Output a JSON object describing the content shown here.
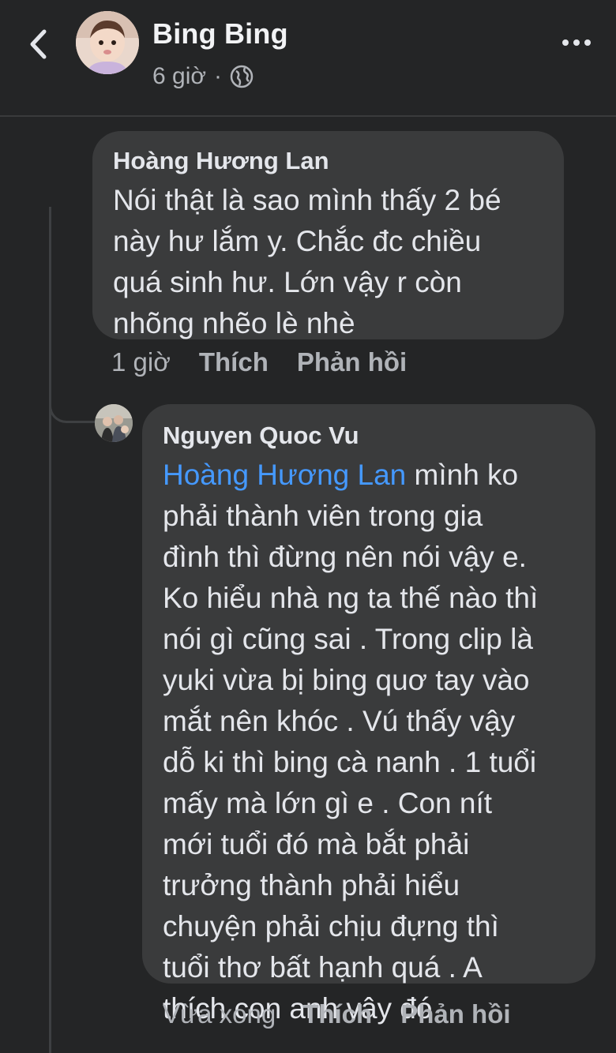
{
  "header": {
    "name": "Bing Bing",
    "time": "6 giờ",
    "separator": "·",
    "audience_icon": "globe-icon",
    "back_icon": "chevron-left-icon",
    "more_icon": "more-horizontal-icon"
  },
  "comments": [
    {
      "author": "Hoàng Hương Lan",
      "lines": [
        "Nói thật là sao mình thấy 2 bé",
        "này hư lắm y. Chắc đc chiều",
        "quá sinh hư. Lớn vậy r còn",
        "nhõng nhẽo lè nhè"
      ],
      "time": "1 giờ",
      "like_label": "Thích",
      "reply_label": "Phản hồi"
    },
    {
      "author": "Nguyen Quoc Vu",
      "mention": "Hoàng Hương Lan",
      "first_line_rest": " mình ko",
      "lines": [
        "phải thành viên trong gia",
        "đình thì đừng nên nói vậy e.",
        "Ko hiểu nhà ng ta thế nào thì",
        "nói gì cũng sai . Trong clip là",
        "yuki vừa bị bing quơ tay vào",
        "mắt nên khóc . Vú thấy vậy",
        "dỗ ki thì bing cà nanh . 1 tuổi",
        "mấy mà lớn gì e . Con nít",
        "mới tuổi đó mà bắt phải",
        "trưởng thành phải hiểu",
        "chuyện phải chịu đựng thì",
        "tuổi thơ bất hạnh quá . A",
        "thích con anh vậy đó ."
      ],
      "time": "Vừa xong",
      "like_label": "Thích",
      "reply_label": "Phản hồi"
    }
  ],
  "colors": {
    "background": "#242526",
    "bubble": "#3a3b3c",
    "mention": "#4599ff",
    "secondary_text": "#b0b3b8"
  }
}
